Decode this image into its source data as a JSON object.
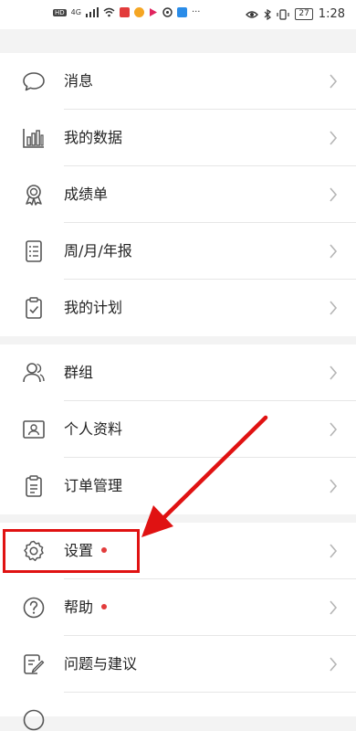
{
  "status_bar": {
    "network": "4G",
    "battery": "27",
    "time": "1:28",
    "left_icons": [
      "hd-icon",
      "signal-icon",
      "wifi-icon",
      "app-icon-red",
      "weibo-icon",
      "video-icon",
      "camera-icon",
      "app-icon-blue",
      "more-icon"
    ],
    "right_icons": [
      "eye-icon",
      "bluetooth-icon",
      "vibrate-icon",
      "battery-icon"
    ]
  },
  "menu": {
    "group1": [
      {
        "label": "消息",
        "icon": "message-icon"
      },
      {
        "label": "我的数据",
        "icon": "bar-chart-icon"
      },
      {
        "label": "成绩单",
        "icon": "medal-icon"
      },
      {
        "label": "周/月/年报",
        "icon": "report-icon"
      },
      {
        "label": "我的计划",
        "icon": "plan-icon"
      }
    ],
    "group2": [
      {
        "label": "群组",
        "icon": "group-icon"
      },
      {
        "label": "个人资料",
        "icon": "profile-card-icon"
      },
      {
        "label": "订单管理",
        "icon": "order-icon"
      }
    ],
    "group3": [
      {
        "label": "设置",
        "icon": "gear-icon",
        "badge": true
      },
      {
        "label": "帮助",
        "icon": "help-icon",
        "badge": true
      },
      {
        "label": "问题与建议",
        "icon": "feedback-icon"
      }
    ]
  },
  "colors": {
    "background": "#f3f3f3",
    "row_background": "#ffffff",
    "icon": "#555555",
    "chevron": "#b5b5b5",
    "badge": "#e23b3b",
    "annotation": "#e01212"
  }
}
